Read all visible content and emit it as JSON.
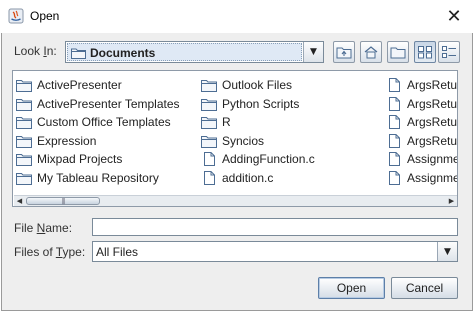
{
  "window": {
    "title": "Open",
    "close_glyph": "✕"
  },
  "look_in": {
    "label_pre": "Look ",
    "label_mn": "I",
    "label_post": "n:",
    "value": "Documents"
  },
  "toolbar": {
    "buttons": [
      "up-one-level-icon",
      "home-icon",
      "new-folder-icon",
      "list-view-icon",
      "details-view-icon"
    ]
  },
  "files": [
    {
      "name": "ActivePresenter",
      "type": "folder"
    },
    {
      "name": "ActivePresenter Templates",
      "type": "folder"
    },
    {
      "name": "Custom Office Templates",
      "type": "folder"
    },
    {
      "name": "Expression",
      "type": "folder"
    },
    {
      "name": "Mixpad Projects",
      "type": "folder"
    },
    {
      "name": "My Tableau Repository",
      "type": "folder"
    },
    {
      "name": "Outlook Files",
      "type": "folder"
    },
    {
      "name": "Python Scripts",
      "type": "folder"
    },
    {
      "name": "R",
      "type": "folder"
    },
    {
      "name": "Syncios",
      "type": "folder"
    },
    {
      "name": "AddingFunction.c",
      "type": "file"
    },
    {
      "name": "addition.c",
      "type": "file"
    },
    {
      "name": "ArgsRetur",
      "type": "file"
    },
    {
      "name": "ArgsRetur",
      "type": "file"
    },
    {
      "name": "ArgsRetur",
      "type": "file"
    },
    {
      "name": "ArgsRetur",
      "type": "file"
    },
    {
      "name": "Assignme",
      "type": "file"
    },
    {
      "name": "Assignme",
      "type": "file"
    }
  ],
  "file_name": {
    "label_pre": "File ",
    "label_mn": "N",
    "label_post": "ame:",
    "value": ""
  },
  "file_type": {
    "label_pre": "Files of ",
    "label_mn": "T",
    "label_post": "ype:",
    "value": "All Files"
  },
  "buttons": {
    "open": "Open",
    "cancel": "Cancel"
  },
  "colors": {
    "folder_fill": "#f3f6fa",
    "folder_stroke": "#4d6d93",
    "accent": "#5d7fa8"
  }
}
